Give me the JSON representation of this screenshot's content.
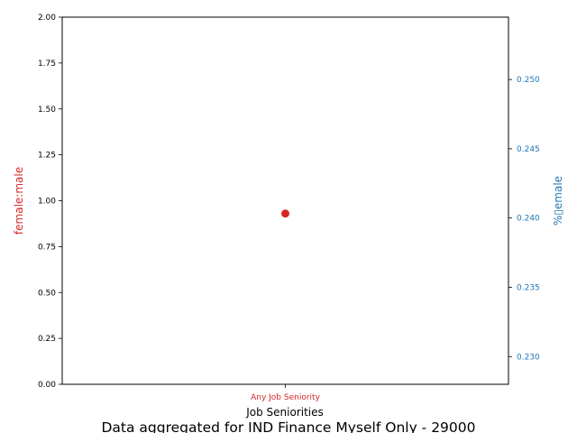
{
  "chart_data": {
    "type": "scatter",
    "caption": "Data aggregated for IND Finance Myself Only - 29000",
    "xlabel": "Job Seniorities",
    "categories": [
      "Any Job Seniority"
    ],
    "left_axis": {
      "label": "female:male",
      "color": "#d62728",
      "ylim": [
        0,
        2
      ],
      "ticks": [
        "0.00",
        "0.25",
        "0.50",
        "0.75",
        "1.00",
        "1.25",
        "1.50",
        "1.75",
        "2.00"
      ]
    },
    "right_axis": {
      "label": "%▯еmale",
      "color": "#1f77b4",
      "ylim": [
        0.228,
        0.2545
      ],
      "ticks": [
        "0.230",
        "0.235",
        "0.240",
        "0.245",
        "0.250"
      ]
    },
    "series": [
      {
        "axis": "left",
        "color": "#d62728",
        "points": [
          {
            "x": "Any Job Seniority",
            "y": 0.93
          }
        ]
      }
    ],
    "grid": false
  }
}
